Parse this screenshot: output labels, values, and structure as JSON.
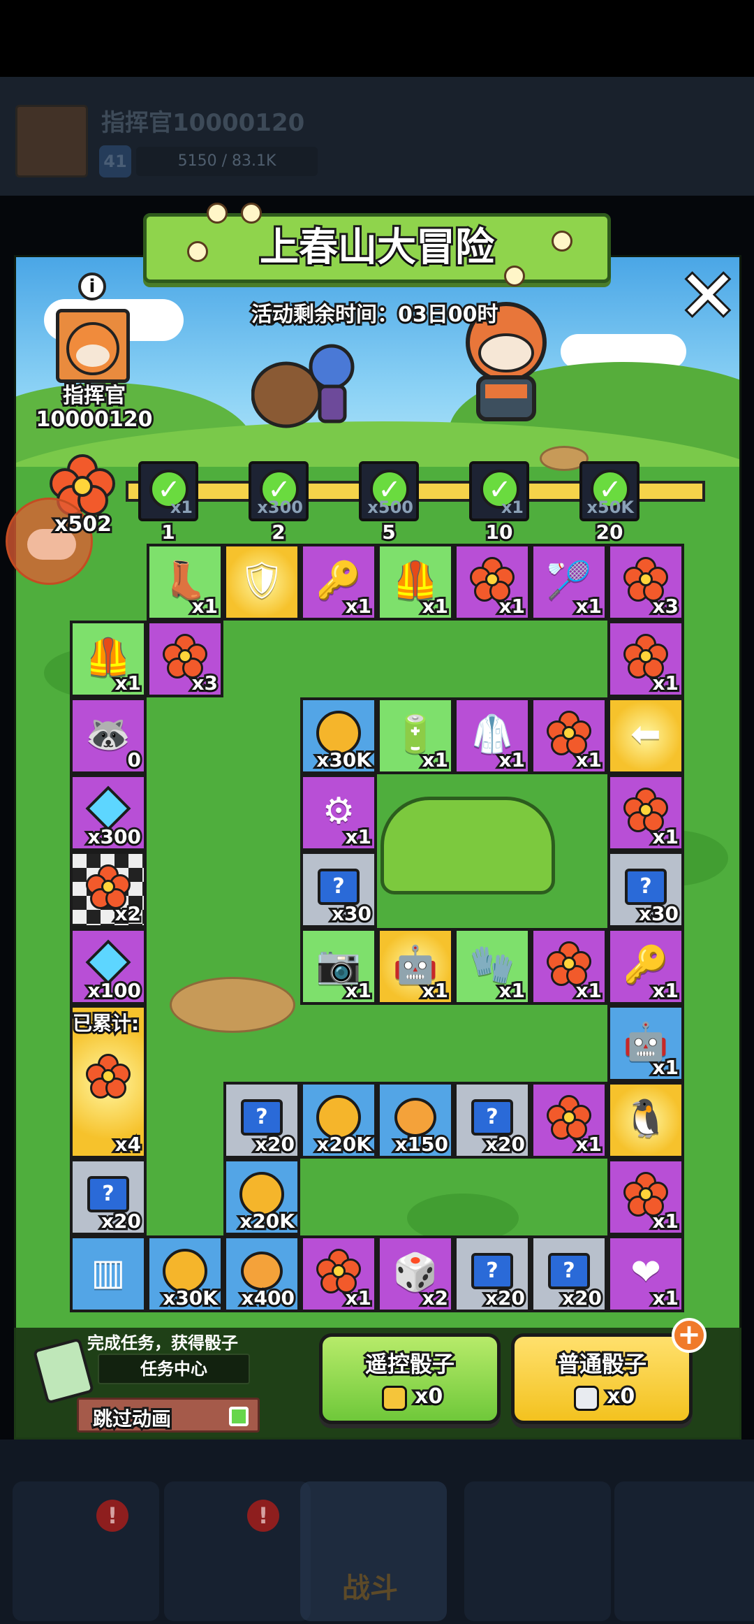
{
  "background": {
    "commander_name": "指挥官10000120",
    "level": "41",
    "exp": "5150 / 83.1K",
    "nav_fight_label": "战斗"
  },
  "event": {
    "title": "上春山大冒险",
    "timer": "活动剩余时间：03日00时",
    "commander_label": "指挥官10000120",
    "flower_count": "x502",
    "accumulated_label": "已累计:"
  },
  "milestones": [
    {
      "amount": "x1",
      "label": "1"
    },
    {
      "amount": "x300",
      "label": "2"
    },
    {
      "amount": "x500",
      "label": "5"
    },
    {
      "amount": "x1",
      "label": "10"
    },
    {
      "amount": "x50K",
      "label": "20"
    }
  ],
  "cells": [
    {
      "id": "r1c1",
      "type": "boot",
      "amount": "x1",
      "icon": "boot-icon"
    },
    {
      "id": "r1c2",
      "type": "badge",
      "amount": "",
      "icon": "wing-badge-icon"
    },
    {
      "id": "r1c3",
      "type": "key",
      "amount": "x1",
      "icon": "key-icon"
    },
    {
      "id": "r1c4",
      "type": "armor",
      "amount": "x1",
      "icon": "armor-icon"
    },
    {
      "id": "r1c5",
      "type": "flower",
      "amount": "x1",
      "icon": "flower-icon"
    },
    {
      "id": "r1c6",
      "type": "racket",
      "amount": "x1",
      "icon": "racket-icon"
    },
    {
      "id": "r1c7",
      "type": "flower",
      "amount": "x3",
      "icon": "flower-icon"
    },
    {
      "id": "r2c0",
      "type": "armor",
      "amount": "x1",
      "icon": "armor-icon"
    },
    {
      "id": "r2c1",
      "type": "flower",
      "amount": "x3",
      "icon": "flower-icon"
    },
    {
      "id": "r2c7",
      "type": "flower",
      "amount": "x1",
      "icon": "flower-icon"
    },
    {
      "id": "r3c0",
      "type": "player",
      "amount": "0",
      "icon": "raccoon-player-icon"
    },
    {
      "id": "r3c3",
      "type": "coin",
      "amount": "x30K",
      "icon": "coin-icon"
    },
    {
      "id": "r3c4",
      "type": "battery",
      "amount": "x1",
      "icon": "battery-icon"
    },
    {
      "id": "r3c5",
      "type": "suit",
      "amount": "x1",
      "icon": "suit-icon"
    },
    {
      "id": "r3c6",
      "type": "flower",
      "amount": "x1",
      "icon": "flower-icon"
    },
    {
      "id": "r3c7",
      "type": "arrow",
      "amount": "",
      "icon": "arrow-sign-icon"
    },
    {
      "id": "r4c0",
      "type": "gem",
      "amount": "x300",
      "icon": "gem-icon"
    },
    {
      "id": "r4c3",
      "type": "gear",
      "amount": "x1",
      "icon": "gear-armor-icon"
    },
    {
      "id": "r4c7",
      "type": "flower",
      "amount": "x1",
      "icon": "flower-icon"
    },
    {
      "id": "r5c0",
      "type": "flower",
      "amount": "x2",
      "icon": "flower-icon"
    },
    {
      "id": "r5c3",
      "type": "mystery",
      "amount": "x30",
      "icon": "mystery-box-icon"
    },
    {
      "id": "r5c7",
      "type": "mystery",
      "amount": "x30",
      "icon": "mystery-box-icon"
    },
    {
      "id": "r6c0",
      "type": "gem",
      "amount": "x100",
      "icon": "gem-icon"
    },
    {
      "id": "r6c3",
      "type": "camera",
      "amount": "x1",
      "icon": "camera-icon"
    },
    {
      "id": "r6c4",
      "type": "robot",
      "amount": "x1",
      "icon": "robot-icon"
    },
    {
      "id": "r6c5",
      "type": "glove",
      "amount": "x1",
      "icon": "glove-icon"
    },
    {
      "id": "r6c6",
      "type": "flower",
      "amount": "x1",
      "icon": "flower-icon"
    },
    {
      "id": "r6c7",
      "type": "key",
      "amount": "x1",
      "icon": "key-icon"
    },
    {
      "id": "r7c7",
      "type": "robot",
      "amount": "x1",
      "icon": "robot-icon"
    },
    {
      "id": "r8c0",
      "type": "flower",
      "amount": "x4",
      "icon": "flower-icon"
    },
    {
      "id": "r8c2",
      "type": "mystery",
      "amount": "x20",
      "icon": "mystery-box-icon"
    },
    {
      "id": "r8c3",
      "type": "coin",
      "amount": "x20K",
      "icon": "coin-icon"
    },
    {
      "id": "r8c4",
      "type": "ball",
      "amount": "x150",
      "icon": "ball-icon"
    },
    {
      "id": "r8c5",
      "type": "mystery",
      "amount": "x20",
      "icon": "mystery-box-icon"
    },
    {
      "id": "r8c6",
      "type": "flower",
      "amount": "x1",
      "icon": "flower-icon"
    },
    {
      "id": "r8c7",
      "type": "penguin",
      "amount": "",
      "icon": "penguin-icon"
    },
    {
      "id": "r9c0",
      "type": "mystery",
      "amount": "x20",
      "icon": "mystery-box-icon"
    },
    {
      "id": "r9c2",
      "type": "coin",
      "amount": "x20K",
      "icon": "coin-icon"
    },
    {
      "id": "r9c7",
      "type": "flower",
      "amount": "x1",
      "icon": "flower-icon"
    },
    {
      "id": "r10c0",
      "type": "gate",
      "amount": "",
      "icon": "gate-icon"
    },
    {
      "id": "r10c1",
      "type": "coin",
      "amount": "x30K",
      "icon": "coin-icon"
    },
    {
      "id": "r10c2",
      "type": "ball",
      "amount": "x400",
      "icon": "ball-icon"
    },
    {
      "id": "r10c3",
      "type": "flower",
      "amount": "x1",
      "icon": "flower-icon"
    },
    {
      "id": "r10c4",
      "type": "dice",
      "amount": "x2",
      "icon": "dice-icon"
    },
    {
      "id": "r10c5",
      "type": "mystery",
      "amount": "x20",
      "icon": "mystery-box-icon"
    },
    {
      "id": "r10c6",
      "type": "mystery",
      "amount": "x20",
      "icon": "mystery-box-icon"
    },
    {
      "id": "r10c7",
      "type": "heart",
      "amount": "x1",
      "icon": "heart-icon"
    }
  ],
  "bottom": {
    "task_text": "完成任务，获得骰子",
    "task_center": "任务中心",
    "skip_label": "跳过动画",
    "remote_label": "遥控骰子",
    "remote_count": "x0",
    "normal_label": "普通骰子",
    "normal_count": "x0",
    "plus": "+"
  },
  "close": "✕",
  "info": "i",
  "colors": {
    "flower": "#f25a2b",
    "check": "#6adb3f",
    "accent": "#f3c21f",
    "panel_green": "#48a83a"
  }
}
